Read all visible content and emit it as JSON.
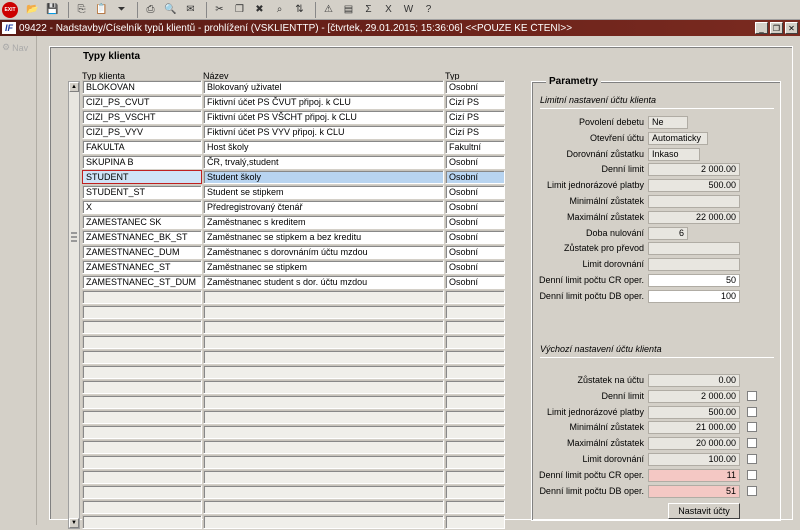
{
  "toolbar": {
    "exit_label": "EXIT",
    "icons": [
      "folder-icon",
      "save-icon",
      "copy-icon",
      "paste-icon",
      "filter-icon",
      "print-icon",
      "preview-icon",
      "mail-icon",
      "cut-icon",
      "copy2-icon",
      "delete-icon",
      "find-icon",
      "sort-icon",
      "warning-icon",
      "chart-icon",
      "sigma-icon",
      "excel-icon",
      "word-icon",
      "help-icon"
    ]
  },
  "window": {
    "title": "09422 - Nadstavby/Číselník typů klientů - prohlížení (VSKLIENTTP) - [čtvrtek, 29.01.2015; 15:36:06] <<POUZE KE ČTENÍ>>",
    "logo": "IF"
  },
  "nav": {
    "label": "Nav"
  },
  "clients": {
    "group_title": "Typy klienta",
    "headers": {
      "typ_klienta": "Typ klienta",
      "nazev": "Název",
      "typ": "Typ"
    },
    "rows": [
      {
        "code": "BLOKOVAN",
        "name": "Blokovaný uživatel",
        "type": "Osobní"
      },
      {
        "code": "CIZI_PS_CVUT",
        "name": "Fiktivní účet  PS ČVUT připoj. k CLU",
        "type": "Cizí PS"
      },
      {
        "code": "CIZI_PS_VSCHT",
        "name": "Fiktivní účet  PS VŠCHT připoj. k CLU",
        "type": "Cizí PS"
      },
      {
        "code": "CIZI_PS_VYV",
        "name": "Fiktivní účet  PS VYV připoj. k CLU",
        "type": "Cizí PS"
      },
      {
        "code": "FAKULTA",
        "name": "Host školy",
        "type": "Fakultní"
      },
      {
        "code": "SKUPINA B",
        "name": "ČR, trvalý,student",
        "type": "Osobní"
      },
      {
        "code": "STUDENT",
        "name": "Student školy",
        "type": "Osobní"
      },
      {
        "code": "STUDENT_ST",
        "name": "Student se stipkem",
        "type": "Osobní"
      },
      {
        "code": "X",
        "name": "Předregistrovaný čtenář",
        "type": "Osobní"
      },
      {
        "code": "ZAMESTANEC SK",
        "name": "Zaměstnanec s kreditem",
        "type": "Osobní"
      },
      {
        "code": "ZAMESTNANEC_BK_ST",
        "name": "Zaměstnanec se stipkem a bez kreditu",
        "type": "Osobní"
      },
      {
        "code": "ZAMESTNANEC_DUM",
        "name": "Zaměstnanec s dorovnáním účtu mzdou",
        "type": "Osobní"
      },
      {
        "code": "ZAMESTNANEC_ST",
        "name": "Zaměstnanec se stipkem",
        "type": "Osobní"
      },
      {
        "code": "ZAMESTNANEC_ST_DUM",
        "name": "Zaměstnanec student s dor. účtu mzdou",
        "type": "Osobní"
      }
    ],
    "selected_index": 6
  },
  "params": {
    "title": "Parametry",
    "limits_title": "Limitní nastavení účtu klienta",
    "limits": [
      {
        "label": "Povolení debetu",
        "value": "Ne",
        "align": "l",
        "w": 40,
        "style": "grey"
      },
      {
        "label": "Otevření účtu",
        "value": "Automaticky",
        "align": "l",
        "w": 60,
        "style": "grey"
      },
      {
        "label": "Dorovnání zůstatku",
        "value": "Inkaso",
        "align": "l",
        "w": 52,
        "style": "grey"
      },
      {
        "label": "Denní limit",
        "value": "2 000.00",
        "align": "r",
        "w": 92,
        "style": "grey"
      },
      {
        "label": "Limit jednorázové platby",
        "value": "500.00",
        "align": "r",
        "w": 92,
        "style": "grey"
      },
      {
        "label": "Minimální zůstatek",
        "value": "",
        "align": "r",
        "w": 92,
        "style": "grey"
      },
      {
        "label": "Maximální zůstatek",
        "value": "22 000.00",
        "align": "r",
        "w": 92,
        "style": "grey"
      },
      {
        "label": "Doba nulování",
        "value": "6",
        "align": "r",
        "w": 40,
        "style": "grey"
      },
      {
        "label": "Zůstatek pro převod",
        "value": "",
        "align": "r",
        "w": 92,
        "style": "grey"
      },
      {
        "label": "Limit dorovnání",
        "value": "",
        "align": "r",
        "w": 92,
        "style": "grey"
      },
      {
        "label": "Denní limit počtu CR oper.",
        "value": "50",
        "align": "r",
        "w": 92,
        "style": "white"
      },
      {
        "label": "Denní limit počtu DB oper.",
        "value": "100",
        "align": "r",
        "w": 92,
        "style": "white"
      }
    ],
    "defaults_title": "Výchozí nastavení účtu klienta",
    "defaults": [
      {
        "label": "Zůstatek na účtu",
        "value": "0.00",
        "style": "grey",
        "check": false
      },
      {
        "label": "Denní limit",
        "value": "2 000.00",
        "style": "grey",
        "check": true
      },
      {
        "label": "Limit jednorázové platby",
        "value": "500.00",
        "style": "grey",
        "check": true
      },
      {
        "label": "Minimální zůstatek",
        "value": "21 000.00",
        "style": "grey",
        "check": true
      },
      {
        "label": "Maximální zůstatek",
        "value": "20 000.00",
        "style": "grey",
        "check": true
      },
      {
        "label": "Limit dorovnání",
        "value": "100.00",
        "style": "grey",
        "check": true
      },
      {
        "label": "Denní limit počtu CR oper.",
        "value": "11",
        "style": "pink",
        "check": true
      },
      {
        "label": "Denní limit počtu DB oper.",
        "value": "51",
        "style": "pink",
        "check": true
      }
    ],
    "button_label": "Nastavit účty"
  }
}
